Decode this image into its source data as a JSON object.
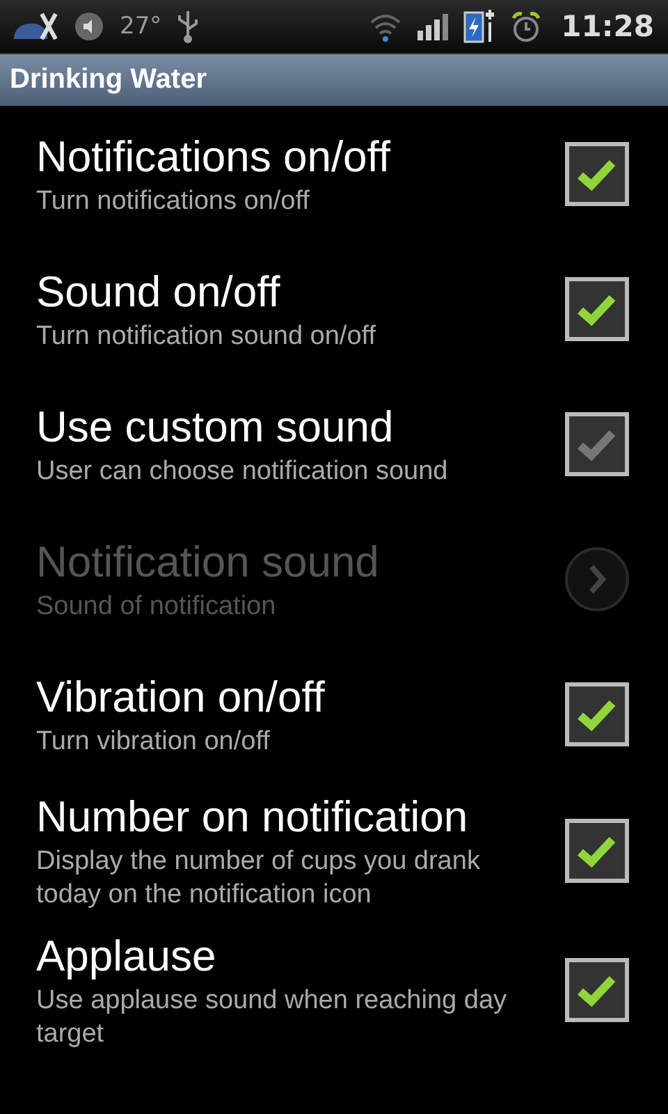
{
  "status_bar": {
    "temperature": "27°",
    "time": "11:28"
  },
  "title_bar": {
    "title": "Drinking Water"
  },
  "settings": [
    {
      "kind": "checkbox",
      "title": "Notifications on/off",
      "summary": "Turn notifications on/off",
      "checked": true,
      "disabled": false
    },
    {
      "kind": "checkbox",
      "title": "Sound on/off",
      "summary": "Turn notification sound on/off",
      "checked": true,
      "disabled": false
    },
    {
      "kind": "checkbox",
      "title": "Use custom sound",
      "summary": "User can choose notification sound",
      "checked": false,
      "disabled": false
    },
    {
      "kind": "link",
      "title": "Notification sound",
      "summary": "Sound of notification",
      "disabled": true
    },
    {
      "kind": "checkbox",
      "title": "Vibration on/off",
      "summary": "Turn vibration on/off",
      "checked": true,
      "disabled": false
    },
    {
      "kind": "checkbox",
      "title": "Number on notification",
      "summary": "Display the number of cups you drank today on the notification icon",
      "checked": true,
      "disabled": false
    },
    {
      "kind": "checkbox",
      "title": "Applause",
      "summary": "Use applause sound when reaching day target",
      "checked": true,
      "disabled": false
    }
  ]
}
